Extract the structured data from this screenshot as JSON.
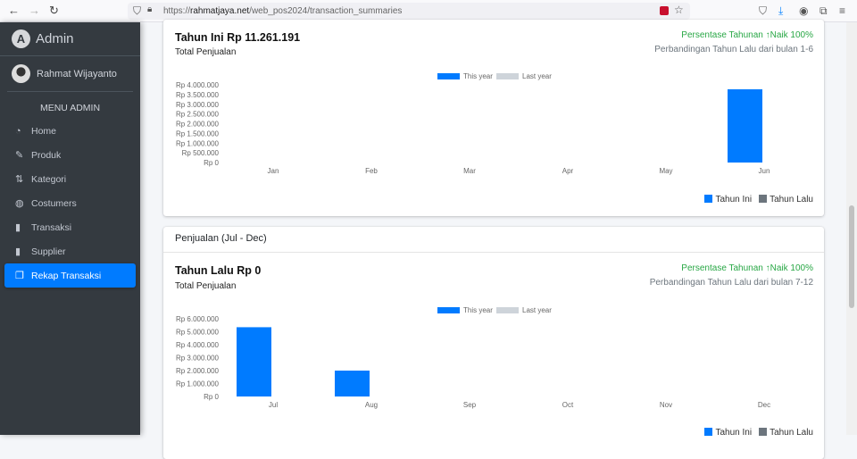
{
  "browser": {
    "url_prefix": "https://",
    "url_domain": "rahmatjaya.net",
    "url_path": "/web_pos2024/transaction_summaries"
  },
  "sidebar": {
    "brand": "Admin",
    "user": "Rahmat Wijayanto",
    "menu_header": "MENU ADMIN",
    "items": [
      {
        "label": "Home",
        "icon": "tachometer-icon"
      },
      {
        "label": "Produk",
        "icon": "edit-icon"
      },
      {
        "label": "Kategori",
        "icon": "exchange-icon"
      },
      {
        "label": "Costumers",
        "icon": "fingerprint-icon"
      },
      {
        "label": "Transaksi",
        "icon": "clipboard-icon"
      },
      {
        "label": "Supplier",
        "icon": "clipboard-icon"
      },
      {
        "label": "Rekap Transaksi",
        "icon": "copy-icon",
        "active": true
      }
    ]
  },
  "cards": [
    {
      "title": "Tahun Ini Rp 11.261.191",
      "subtitle": "Total Penjualan",
      "pct": "Persentase Tahunan",
      "pct_value": "Naik 100%",
      "compare": "Perbandingan Tahun Lalu dari bulan 1-6",
      "legend_this": "Tahun Ini",
      "legend_last": "Tahun Lalu"
    },
    {
      "header": "Penjualan (Jul - Dec)",
      "title": "Tahun Lalu Rp 0",
      "subtitle": "Total Penjualan",
      "pct": "Persentase Tahunan",
      "pct_value": "Naik 100%",
      "compare": "Perbandingan Tahun Lalu dari bulan 7-12",
      "legend_this": "Tahun Ini",
      "legend_last": "Tahun Lalu"
    }
  ],
  "colors": {
    "this_year": "#007bff",
    "last_year": "#ced4da",
    "accent": "#007bff",
    "success": "#28a745"
  },
  "chart_data": [
    {
      "type": "bar",
      "categories": [
        "Jan",
        "Feb",
        "Mar",
        "Apr",
        "May",
        "Jun"
      ],
      "series": [
        {
          "name": "This year",
          "values": [
            0,
            0,
            0,
            0,
            0,
            3770000
          ]
        },
        {
          "name": "Last year",
          "values": [
            0,
            0,
            0,
            0,
            0,
            0
          ]
        }
      ],
      "ylim": [
        0,
        4000000
      ],
      "yticks": [
        "Rp 0",
        "Rp 500.000",
        "Rp 1.000.000",
        "Rp 1.500.000",
        "Rp 2.000.000",
        "Rp 2.500.000",
        "Rp 3.000.000",
        "Rp 3.500.000",
        "Rp 4.000.000"
      ],
      "legend": "top"
    },
    {
      "type": "bar",
      "categories": [
        "Jul",
        "Aug",
        "Sep",
        "Oct",
        "Nov",
        "Dec"
      ],
      "series": [
        {
          "name": "This year",
          "values": [
            5350000,
            2000000,
            0,
            0,
            0,
            0
          ]
        },
        {
          "name": "Last year",
          "values": [
            0,
            0,
            0,
            0,
            0,
            0
          ]
        }
      ],
      "ylim": [
        0,
        6000000
      ],
      "yticks": [
        "Rp 0",
        "Rp 1.000.000",
        "Rp 2.000.000",
        "Rp 3.000.000",
        "Rp 4.000.000",
        "Rp 5.000.000",
        "Rp 6.000.000"
      ],
      "legend": "top"
    }
  ]
}
